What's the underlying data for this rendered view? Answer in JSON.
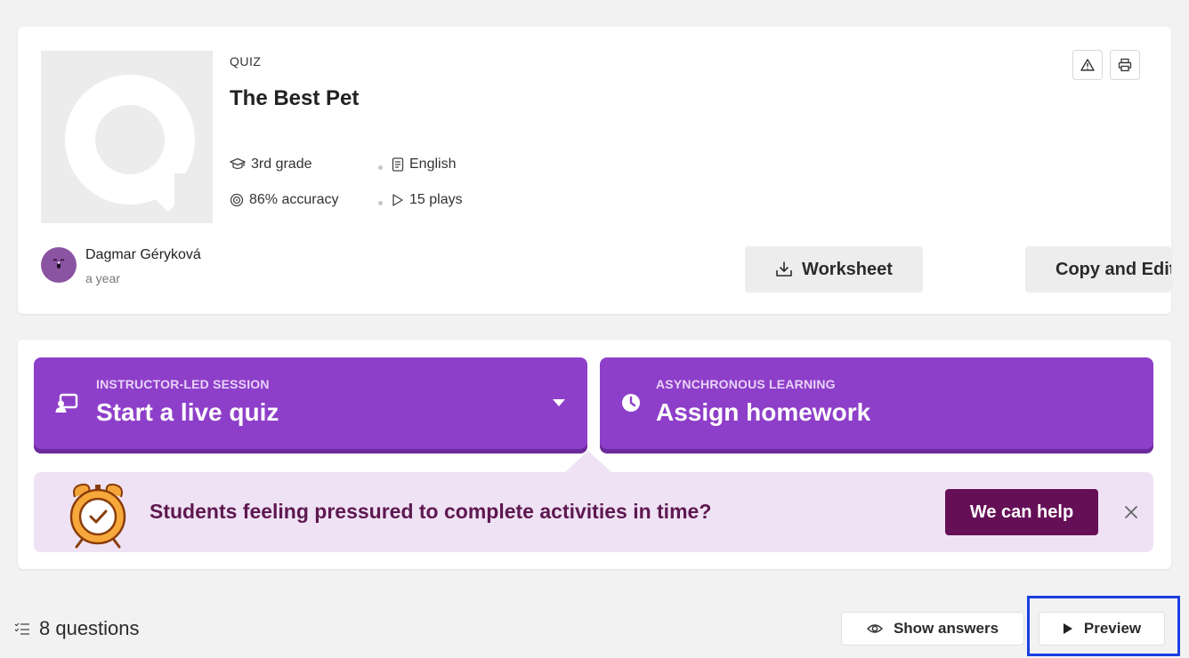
{
  "quiz": {
    "type_label": "QUIZ",
    "title": "The Best Pet",
    "grade": "3rd grade",
    "language": "English",
    "accuracy": "86% accuracy",
    "plays": "15 plays"
  },
  "author": {
    "name": "Dagmar Géryková",
    "time": "a year"
  },
  "actions": {
    "worksheet_label": "Worksheet",
    "copy_label": "Copy and Edit"
  },
  "live": {
    "subtitle": "INSTRUCTOR-LED SESSION",
    "label": "Start a live quiz"
  },
  "homework": {
    "subtitle": "ASYNCHRONOUS LEARNING",
    "label": "Assign homework"
  },
  "promo": {
    "text": "Students feeling pressured to complete activities in time?",
    "button_label": "We can help"
  },
  "footer": {
    "questions_count": "8 questions",
    "show_answers_label": "Show answers",
    "preview_label": "Preview"
  },
  "colors": {
    "brand_purple": "#8e3fc9",
    "promo_bg": "#efe2f5",
    "help_button": "#650f57",
    "highlight": "#1a3fe0"
  }
}
